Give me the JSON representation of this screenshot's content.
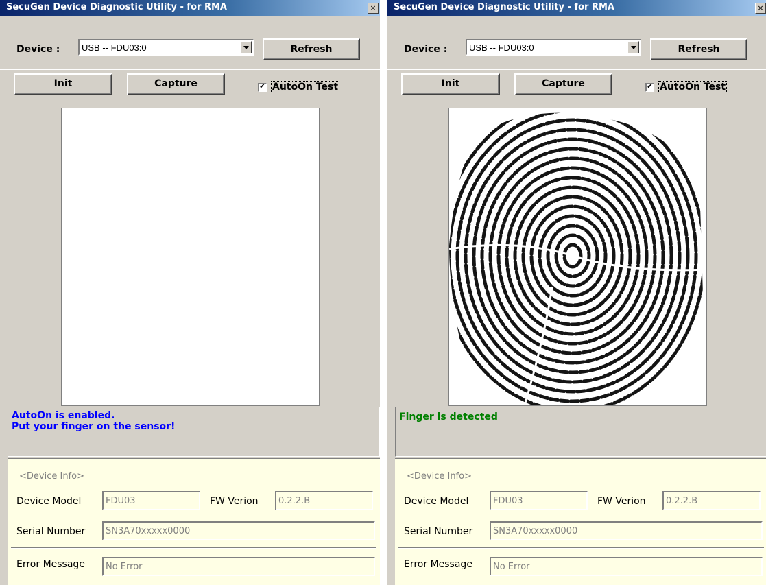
{
  "windows": [
    {
      "title": "SecuGen Device Diagnostic Utility - for RMA",
      "close_glyph": "×",
      "device_label": "Device :",
      "device_value": "USB -- FDU03:0",
      "refresh_label": "Refresh",
      "init_label": "Init",
      "capture_label": "Capture",
      "autoon_label": "AutoOn Test",
      "autoon_checked": true,
      "has_fingerprint": false,
      "status_lines": [
        "AutoOn is enabled.",
        "Put your finger on the sensor!"
      ],
      "status_color": "#0000ff",
      "info": {
        "header": "<Device Info>",
        "model_label": "Device Model",
        "model_value": "FDU03",
        "fw_label": "FW Verion",
        "fw_value": "0.2.2.B",
        "serial_label": "Serial Number",
        "serial_value": "SN3A70xxxxx0000",
        "error_label": "Error Message",
        "error_value": "No Error"
      }
    },
    {
      "title": "SecuGen Device Diagnostic Utility - for RMA",
      "close_glyph": "×",
      "device_label": "Device :",
      "device_value": "USB -- FDU03:0",
      "refresh_label": "Refresh",
      "init_label": "Init",
      "capture_label": "Capture",
      "autoon_label": "AutoOn Test",
      "autoon_checked": true,
      "has_fingerprint": true,
      "status_lines": [
        "Finger is detected"
      ],
      "status_color": "#008000",
      "info": {
        "header": "<Device Info>",
        "model_label": "Device Model",
        "model_value": "FDU03",
        "fw_label": "FW Verion",
        "fw_value": "0.2.2.B",
        "serial_label": "Serial Number",
        "serial_value": "SN3A70xxxxx0000",
        "error_label": "Error Message",
        "error_value": "No Error"
      }
    }
  ]
}
